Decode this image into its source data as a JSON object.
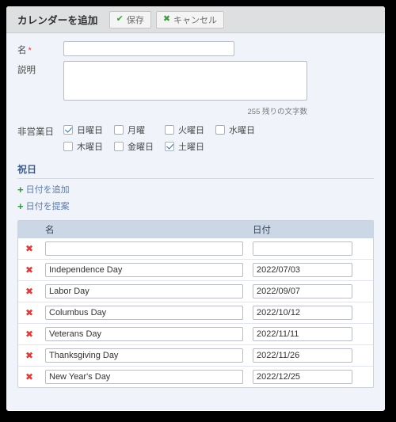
{
  "toolbar": {
    "title": "カレンダーを追加",
    "save_label": "保存",
    "save_icon": "check-icon",
    "cancel_label": "キャンセル",
    "cancel_icon": "x-icon"
  },
  "form": {
    "name_label": "名",
    "name_required_mark": "*",
    "name_value": "",
    "description_label": "説明",
    "description_value": "",
    "char_counter": "255 残りの文字数",
    "closed_days_label": "非営業日"
  },
  "closed_days": {
    "row1": [
      {
        "label": "日曜日",
        "checked": true
      },
      {
        "label": "月曜",
        "checked": false
      },
      {
        "label": "火曜日",
        "checked": false
      },
      {
        "label": "水曜日",
        "checked": false
      }
    ],
    "row2": [
      {
        "label": "木曜日",
        "checked": false
      },
      {
        "label": "金曜日",
        "checked": false
      },
      {
        "label": "土曜日",
        "checked": true
      }
    ]
  },
  "holidays": {
    "title": "祝日",
    "add_date_label": "日付を追加",
    "suggest_date_label": "日付を提案",
    "columns": {
      "name": "名",
      "date": "日付"
    },
    "rows": [
      {
        "name": "",
        "date": ""
      },
      {
        "name": "Independence Day",
        "date": "2022/07/03"
      },
      {
        "name": "Labor Day",
        "date": "2022/09/07"
      },
      {
        "name": "Columbus Day",
        "date": "2022/10/12"
      },
      {
        "name": "Veterans Day",
        "date": "2022/11/11"
      },
      {
        "name": "Thanksgiving Day",
        "date": "2022/11/26"
      },
      {
        "name": "New Year's Day",
        "date": "2022/12/25"
      }
    ],
    "delete_icon": "✖"
  },
  "colors": {
    "toolbar_bg": "#dddfe1",
    "form_bg": "#f0f3f9",
    "table_header_bg": "#ccd7e5",
    "accent_link": "#5c7ca8",
    "green": "#3b9e3b",
    "red": "#e03b3b",
    "heading": "#3c5a8a"
  }
}
